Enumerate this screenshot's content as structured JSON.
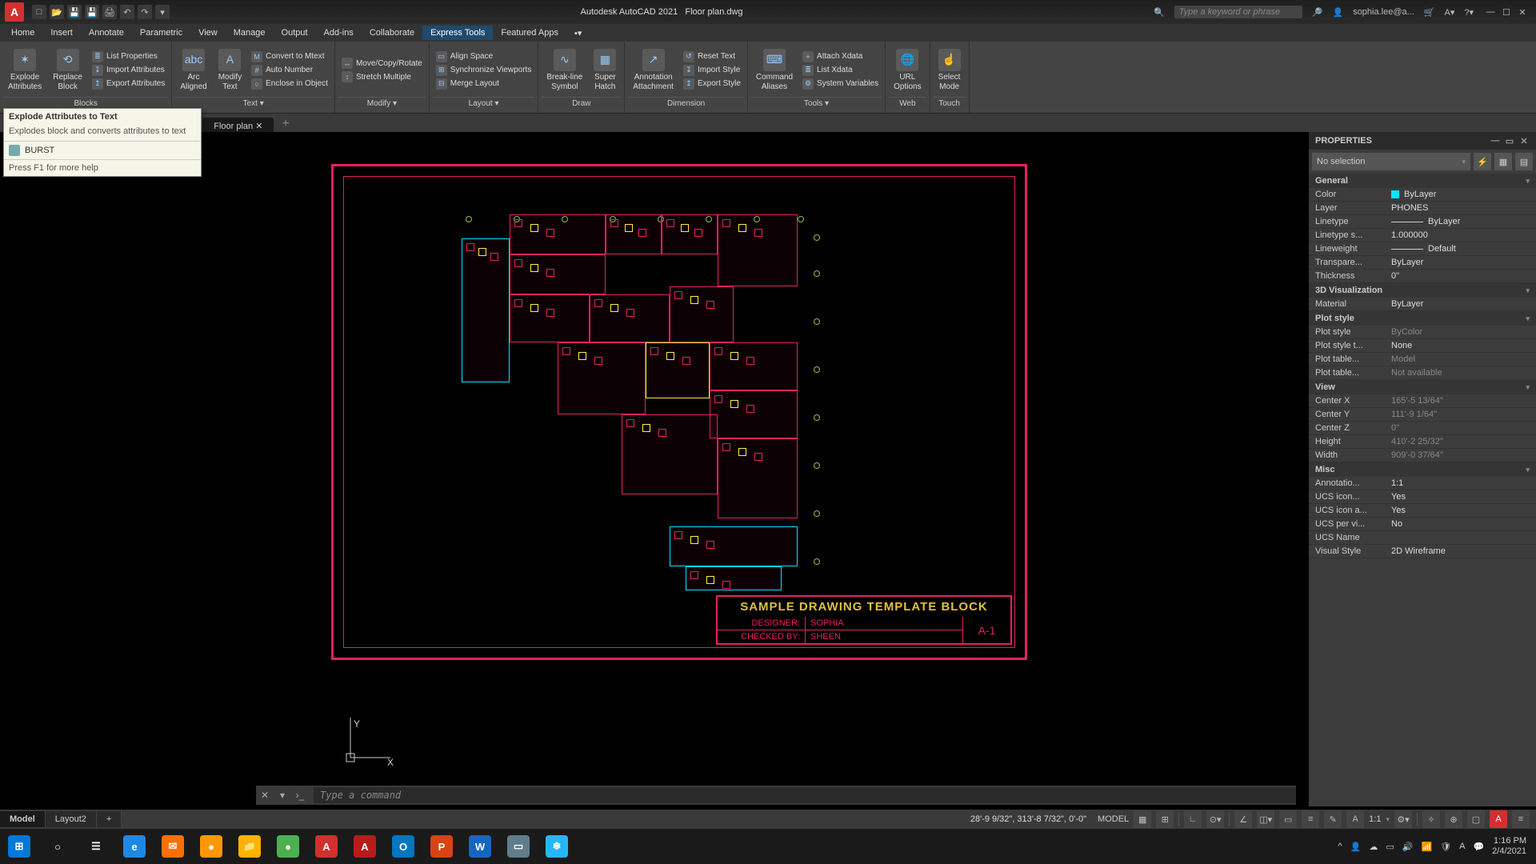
{
  "app": {
    "name": "Autodesk AutoCAD 2021",
    "doc": "Floor plan.dwg"
  },
  "qat_icons": [
    "new",
    "open",
    "save",
    "saveas",
    "plot",
    "undo",
    "redo"
  ],
  "search_placeholder": "Type a keyword or phrase",
  "user": "sophia.lee@a...",
  "menus": [
    "Home",
    "Insert",
    "Annotate",
    "Parametric",
    "View",
    "Manage",
    "Output",
    "Add-ins",
    "Collaborate",
    "Express Tools",
    "Featured Apps"
  ],
  "active_menu": "Express Tools",
  "ribbon_panels": [
    {
      "title": "Blocks",
      "big": [
        {
          "label1": "Explode",
          "label2": "Attributes",
          "icon": "✶"
        },
        {
          "label1": "Replace",
          "label2": "Block",
          "icon": "⟲"
        }
      ],
      "small": [
        {
          "icon": "≣",
          "label": "List Properties"
        },
        {
          "icon": "↧",
          "label": "Import Attributes"
        },
        {
          "icon": "↥",
          "label": "Export Attributes"
        }
      ]
    },
    {
      "title": "Text ▾",
      "big": [
        {
          "label1": "Arc",
          "label2": "Aligned",
          "icon": "abc"
        },
        {
          "label1": "Modify",
          "label2": "Text",
          "icon": "A"
        }
      ],
      "small": [
        {
          "icon": "M",
          "label": "Convert to Mtext"
        },
        {
          "icon": "#",
          "label": "Auto Number"
        },
        {
          "icon": "○",
          "label": "Enclose in Object"
        }
      ]
    },
    {
      "title": "Modify ▾",
      "big": [],
      "small": [
        {
          "icon": "↔",
          "label": "Move/Copy/Rotate"
        },
        {
          "icon": "↕",
          "label": "Stretch Multiple"
        }
      ]
    },
    {
      "title": "Layout ▾",
      "big": [],
      "small": [
        {
          "icon": "▭",
          "label": "Align Space"
        },
        {
          "icon": "⊞",
          "label": "Synchronize Viewports"
        },
        {
          "icon": "⊟",
          "label": "Merge Layout"
        }
      ]
    },
    {
      "title": "Draw",
      "big": [
        {
          "label1": "Break-line",
          "label2": "Symbol",
          "icon": "∿"
        },
        {
          "label1": "Super",
          "label2": "Hatch",
          "icon": "▦"
        }
      ],
      "small": []
    },
    {
      "title": "Dimension",
      "big": [
        {
          "label1": "Annotation",
          "label2": "Attachment",
          "icon": "↗"
        }
      ],
      "small": [
        {
          "icon": "↺",
          "label": "Reset Text"
        },
        {
          "icon": "↧",
          "label": "Import Style"
        },
        {
          "icon": "↥",
          "label": "Export Style"
        }
      ]
    },
    {
      "title": "Tools ▾",
      "big": [
        {
          "label1": "Command",
          "label2": "Aliases",
          "icon": "⌨"
        }
      ],
      "small": [
        {
          "icon": "+",
          "label": "Attach Xdata"
        },
        {
          "icon": "≣",
          "label": "List Xdata"
        },
        {
          "icon": "⚙",
          "label": "System Variables"
        }
      ]
    },
    {
      "title": "Web",
      "big": [
        {
          "label1": "URL",
          "label2": "Options",
          "icon": "🌐"
        }
      ],
      "small": []
    },
    {
      "title": "Touch",
      "big": [
        {
          "label1": "Select",
          "label2": "Mode",
          "icon": "☝"
        }
      ],
      "small": []
    }
  ],
  "filetabs": {
    "active": "Floor plan",
    "add": "+"
  },
  "tooltip": {
    "title": "Explode Attributes to Text",
    "desc": "Explodes block and converts attributes to text",
    "cmd": "BURST",
    "help": "Press F1 for more help"
  },
  "blocks_stub": "Blocks",
  "titleblock": {
    "header": "SAMPLE DRAWING TEMPLATE BLOCK",
    "rows": [
      {
        "label": "DESIGNER:",
        "value": "SOPHIA"
      },
      {
        "label": "CHECKED BY:",
        "value": "SHEEN"
      }
    ],
    "sheet": "A-1"
  },
  "ucs": {
    "x": "X",
    "y": "Y"
  },
  "props": {
    "title": "PROPERTIES",
    "selection": "No selection",
    "groups": [
      {
        "name": "General",
        "rows": [
          {
            "k": "Color",
            "v": "ByLayer",
            "swatch": true
          },
          {
            "k": "Layer",
            "v": "PHONES"
          },
          {
            "k": "Linetype",
            "v": "ByLayer",
            "line": true
          },
          {
            "k": "Linetype s...",
            "v": "1.000000"
          },
          {
            "k": "Lineweight",
            "v": "Default",
            "line": true
          },
          {
            "k": "Transpare...",
            "v": "ByLayer"
          },
          {
            "k": "Thickness",
            "v": "0\""
          }
        ]
      },
      {
        "name": "3D Visualization",
        "rows": [
          {
            "k": "Material",
            "v": "ByLayer"
          }
        ]
      },
      {
        "name": "Plot style",
        "rows": [
          {
            "k": "Plot style",
            "v": "ByColor",
            "dim": true
          },
          {
            "k": "Plot style t...",
            "v": "None"
          },
          {
            "k": "Plot table...",
            "v": "Model",
            "dim": true
          },
          {
            "k": "Plot table...",
            "v": "Not available",
            "dim": true
          }
        ]
      },
      {
        "name": "View",
        "rows": [
          {
            "k": "Center X",
            "v": "165'-5 13/64\"",
            "dim": true
          },
          {
            "k": "Center Y",
            "v": "111'-9 1/64\"",
            "dim": true
          },
          {
            "k": "Center Z",
            "v": "0\"",
            "dim": true
          },
          {
            "k": "Height",
            "v": "410'-2 25/32\"",
            "dim": true
          },
          {
            "k": "Width",
            "v": "909'-0 37/64\"",
            "dim": true
          }
        ]
      },
      {
        "name": "Misc",
        "rows": [
          {
            "k": "Annotatio...",
            "v": "1:1"
          },
          {
            "k": "UCS icon...",
            "v": "Yes"
          },
          {
            "k": "UCS icon a...",
            "v": "Yes"
          },
          {
            "k": "UCS per vi...",
            "v": "No"
          },
          {
            "k": "UCS Name",
            "v": ""
          },
          {
            "k": "Visual Style",
            "v": "2D Wireframe"
          }
        ]
      }
    ]
  },
  "cmd_placeholder": "Type a command",
  "bottom_tabs": [
    "Model",
    "Layout2"
  ],
  "active_bottom_tab": "Model",
  "coords": "28'-9 9/32\", 313'-8 7/32\", 0'-0\"",
  "status_model": "MODEL",
  "status_scale": "1:1",
  "taskbar_apps": [
    {
      "bg": "#0078d7",
      "label": "⊞"
    },
    {
      "bg": "transparent",
      "label": "○"
    },
    {
      "bg": "transparent",
      "label": "☰"
    },
    {
      "bg": "#1e88e5",
      "label": "e"
    },
    {
      "bg": "#ff6f00",
      "label": "✉"
    },
    {
      "bg": "#ff9800",
      "label": "●"
    },
    {
      "bg": "#ffb300",
      "label": "📁"
    },
    {
      "bg": "#4caf50",
      "label": "●"
    },
    {
      "bg": "#d32f2f",
      "label": "A"
    },
    {
      "bg": "#b71c1c",
      "label": "A"
    },
    {
      "bg": "#0277bd",
      "label": "O"
    },
    {
      "bg": "#d84315",
      "label": "P"
    },
    {
      "bg": "#1565c0",
      "label": "W"
    },
    {
      "bg": "#607d8b",
      "label": "▭"
    },
    {
      "bg": "#29b6f6",
      "label": "❄"
    }
  ],
  "tray": {
    "time": "1:16 PM",
    "date": "2/4/2021"
  }
}
